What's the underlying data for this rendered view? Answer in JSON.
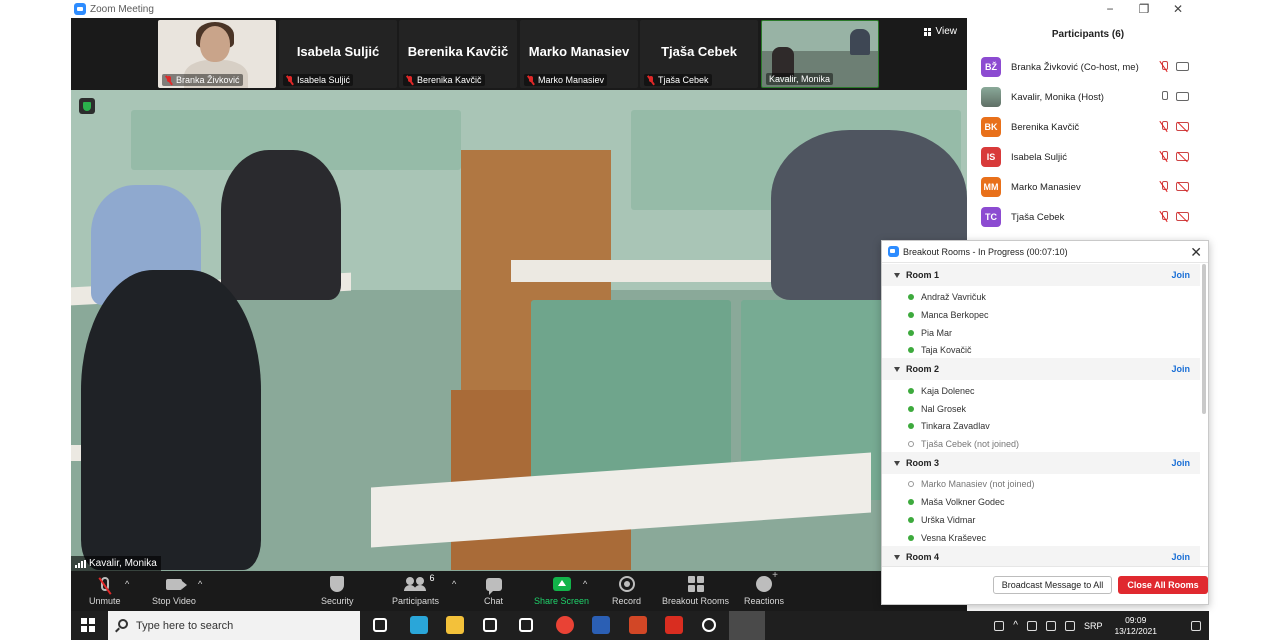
{
  "window": {
    "title": "Zoom Meeting",
    "minimize": "−",
    "restore": "❐",
    "close": "✕"
  },
  "gallery": {
    "thumbs": [
      {
        "name": "",
        "label": "Branka Živković"
      },
      {
        "name": "Isabela Suljić",
        "label": "Isabela Suljić"
      },
      {
        "name": "Berenika Kavčič",
        "label": "Berenika Kavčič"
      },
      {
        "name": "Marko Manasiev",
        "label": "Marko Manasiev"
      },
      {
        "name": "Tjaša Cebek",
        "label": "Tjaša Cebek"
      },
      {
        "name": "",
        "label": "Kavalir, Monika"
      }
    ],
    "view_label": "View"
  },
  "main_video": {
    "speaker": "Kavalir, Monika"
  },
  "toolbar": {
    "unmute": "Unmute",
    "stop_video": "Stop Video",
    "security": "Security",
    "participants": "Participants",
    "participants_count": "6",
    "chat": "Chat",
    "share_screen": "Share Screen",
    "record": "Record",
    "breakout_rooms": "Breakout Rooms",
    "reactions": "Reactions",
    "caret": "^"
  },
  "participants_panel": {
    "title": "Participants (6)",
    "list": [
      {
        "initials": "BŽ",
        "color": "#8c4bd1",
        "name": "Branka Živković (Co-host, me)",
        "mic": "off",
        "cam": "on"
      },
      {
        "initials": "",
        "color": "#7a8e83",
        "name": "Kavalir, Monika (Host)",
        "mic": "on",
        "cam": "on"
      },
      {
        "initials": "BK",
        "color": "#e8701a",
        "name": "Berenika Kavčič",
        "mic": "off",
        "cam": "off"
      },
      {
        "initials": "IS",
        "color": "#d83a3a",
        "name": "Isabela Suljić",
        "mic": "off",
        "cam": "off"
      },
      {
        "initials": "MM",
        "color": "#e8701a",
        "name": "Marko Manasiev",
        "mic": "off",
        "cam": "off"
      },
      {
        "initials": "TC",
        "color": "#8c4bd1",
        "name": "Tjaša Cebek",
        "mic": "off",
        "cam": "off"
      }
    ]
  },
  "breakout": {
    "title": "Breakout Rooms - In Progress (00:07:10)",
    "close": "✕",
    "join_label": "Join",
    "rooms": [
      {
        "name": "Room 1",
        "members": [
          {
            "name": "Andraž Vavričuk",
            "joined": true
          },
          {
            "name": "Manca Berkopec",
            "joined": true
          },
          {
            "name": "Pia Mar",
            "joined": true
          },
          {
            "name": "Taja Kovačič",
            "joined": true
          }
        ]
      },
      {
        "name": "Room 2",
        "members": [
          {
            "name": "Kaja Dolenec",
            "joined": true
          },
          {
            "name": "Nal Grosek",
            "joined": true
          },
          {
            "name": "Tinkara Zavadlav",
            "joined": true
          },
          {
            "name": "Tjaša Cebek (not joined)",
            "joined": false
          }
        ]
      },
      {
        "name": "Room 3",
        "members": [
          {
            "name": "Marko Manasiev (not joined)",
            "joined": false
          },
          {
            "name": "Maša Volkner Godec",
            "joined": true
          },
          {
            "name": "Urška Vidmar",
            "joined": true
          },
          {
            "name": "Vesna Kraševec",
            "joined": true
          }
        ]
      },
      {
        "name": "Room 4",
        "members": []
      }
    ],
    "broadcast_label": "Broadcast Message to All",
    "close_all_label": "Close All Rooms"
  },
  "taskbar": {
    "search_placeholder": "Type here to search",
    "language": "SRP",
    "time": "09:09",
    "date": "13/12/2021",
    "apps": [
      {
        "name": "task-view-icon",
        "color": "#ffffff"
      },
      {
        "name": "edge-icon",
        "color": "#2aa6d9"
      },
      {
        "name": "file-explorer-icon",
        "color": "#f3c13a"
      },
      {
        "name": "store-icon",
        "color": "#ffffff"
      },
      {
        "name": "mail-icon",
        "color": "#ffffff"
      },
      {
        "name": "chrome-icon",
        "color": "#e94235"
      },
      {
        "name": "word-icon",
        "color": "#2b5fb4"
      },
      {
        "name": "powerpoint-icon",
        "color": "#d24726"
      },
      {
        "name": "acrobat-icon",
        "color": "#d92d20"
      },
      {
        "name": "settings-icon",
        "color": "#ffffff"
      },
      {
        "name": "zoom-icon",
        "color": "#2d8cff"
      }
    ]
  }
}
